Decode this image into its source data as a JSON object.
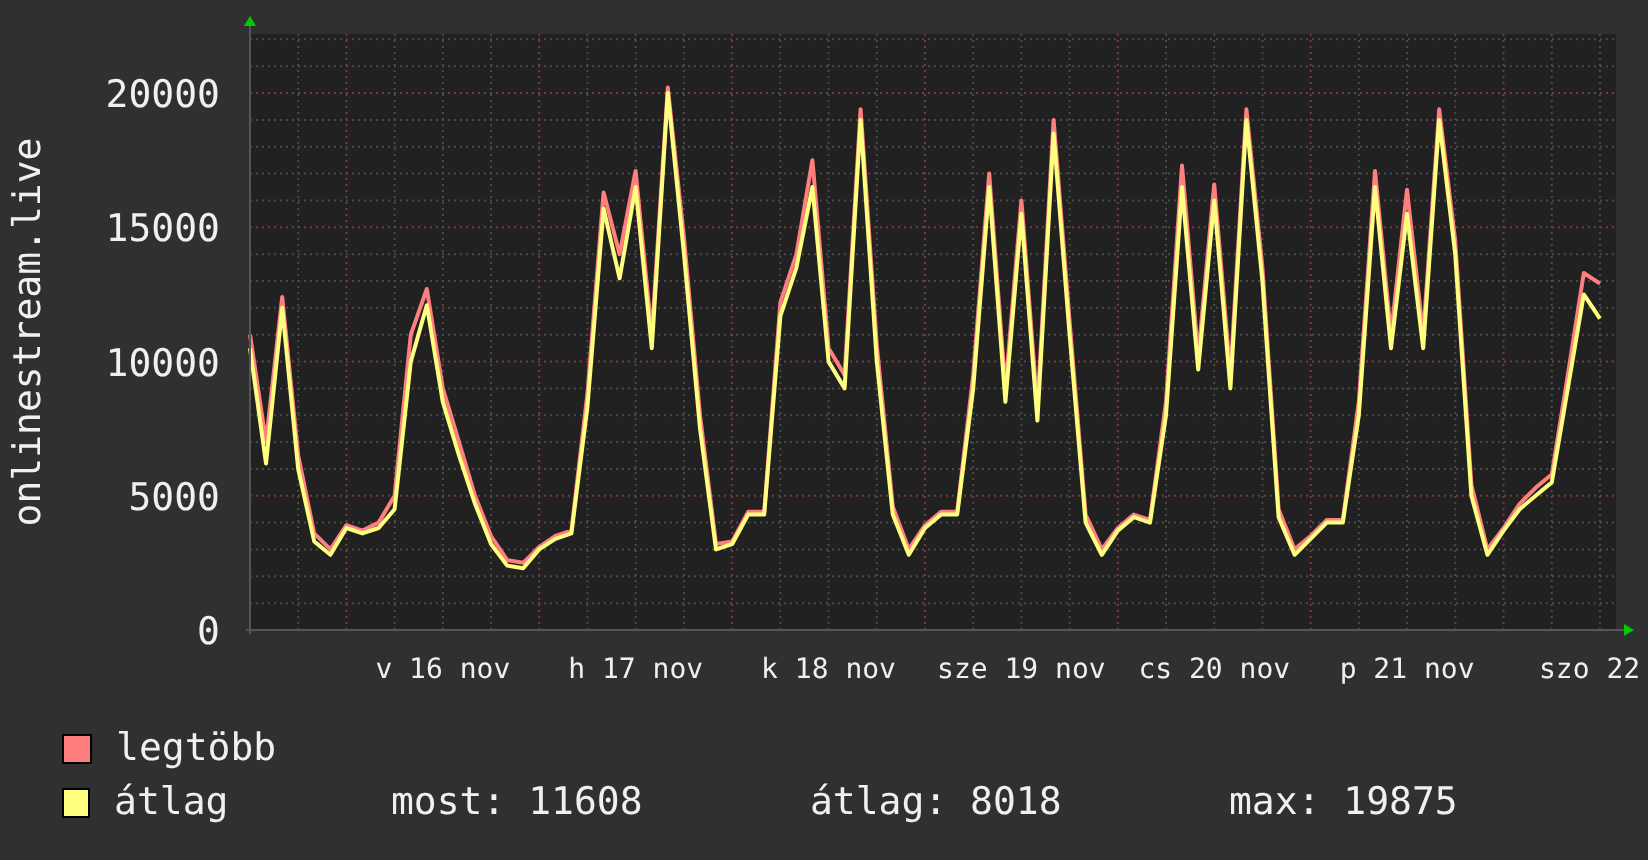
{
  "chart": {
    "chart_data": {
      "type": "line",
      "grid": true,
      "ylabel": "onlinestream.live",
      "ylim": [
        0,
        22200
      ],
      "yticks": [
        0,
        5000,
        10000,
        15000,
        20000
      ],
      "categories": [
        null,
        null,
        null,
        null,
        null,
        null,
        null,
        null,
        null,
        null,
        null,
        null,
        "v 16 nov",
        null,
        null,
        null,
        null,
        null,
        null,
        null,
        null,
        null,
        null,
        null,
        "h 17 nov",
        null,
        null,
        null,
        null,
        null,
        null,
        null,
        null,
        null,
        null,
        null,
        "k 18 nov",
        null,
        null,
        null,
        null,
        null,
        null,
        null,
        null,
        null,
        null,
        null,
        "sze 19 nov",
        null,
        null,
        null,
        null,
        null,
        null,
        null,
        null,
        null,
        null,
        null,
        "cs 20 nov",
        null,
        null,
        null,
        null,
        null,
        null,
        null,
        null,
        null,
        null,
        null,
        "p 21 nov",
        null,
        null,
        null,
        null,
        null,
        null,
        null,
        null,
        null,
        null,
        null,
        "szo 22"
      ],
      "series": [
        {
          "name": "legtöbb",
          "color": "#ff7f7f",
          "values": [
            11000,
            7000,
            12400,
            6500,
            3600,
            3000,
            3900,
            3700,
            4000,
            5000,
            11000,
            12700,
            9000,
            7000,
            5000,
            3500,
            2600,
            2500,
            3100,
            3500,
            3700,
            8800,
            16300,
            14000,
            17100,
            11000,
            20200,
            14600,
            8000,
            3200,
            3300,
            4400,
            4400,
            12200,
            14000,
            17500,
            10500,
            9500,
            19400,
            10600,
            4600,
            3000,
            3900,
            4400,
            4400,
            9500,
            17000,
            9000,
            16000,
            8300,
            19000,
            11500,
            4300,
            3000,
            3800,
            4300,
            4100,
            8500,
            17300,
            10200,
            16600,
            9500,
            19400,
            13500,
            4500,
            3000,
            3500,
            4100,
            4100,
            8500,
            17100,
            11000,
            16400,
            11000,
            19400,
            14500,
            5400,
            3000,
            3800,
            4700,
            5300,
            5800,
            9500,
            13300,
            12900
          ]
        },
        {
          "name": "átlag",
          "color": "#ffff7f",
          "values": [
            10500,
            6200,
            12000,
            6000,
            3300,
            2800,
            3800,
            3600,
            3800,
            4500,
            10000,
            12100,
            8500,
            6500,
            4700,
            3200,
            2400,
            2300,
            3000,
            3400,
            3600,
            8300,
            15700,
            13100,
            16500,
            10500,
            20000,
            14000,
            7500,
            3000,
            3200,
            4300,
            4300,
            11700,
            13500,
            16500,
            10000,
            9000,
            19000,
            10000,
            4300,
            2800,
            3800,
            4300,
            4300,
            9000,
            16500,
            8500,
            15500,
            7800,
            18500,
            11000,
            4000,
            2800,
            3700,
            4200,
            4000,
            8000,
            16500,
            9700,
            16000,
            9000,
            19000,
            13000,
            4200,
            2800,
            3400,
            4000,
            4000,
            8000,
            16500,
            10500,
            15500,
            10500,
            19000,
            14000,
            5000,
            2800,
            3700,
            4500,
            5000,
            5500,
            9000,
            12500,
            11600
          ]
        }
      ]
    }
  },
  "legend_stats": [
    "most: 11608",
    "átlag: 8018",
    "max: 19875"
  ]
}
